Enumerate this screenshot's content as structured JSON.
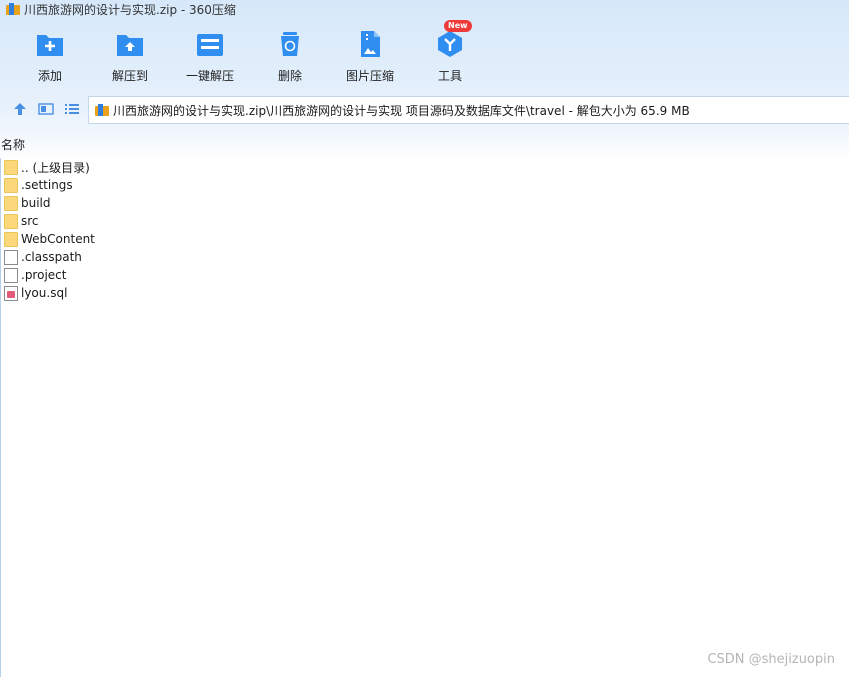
{
  "window": {
    "title": "川西旅游网的设计与实现.zip - 360压缩"
  },
  "toolbar": {
    "buttons": [
      {
        "label": "添加",
        "icon": "add-folder-icon"
      },
      {
        "label": "解压到",
        "icon": "extract-to-icon"
      },
      {
        "label": "一键解压",
        "icon": "one-click-extract-icon"
      },
      {
        "label": "删除",
        "icon": "delete-icon"
      },
      {
        "label": "图片压缩",
        "icon": "image-compress-icon"
      },
      {
        "label": "工具",
        "icon": "tools-icon"
      }
    ],
    "badge": "New"
  },
  "colors": {
    "accent": "#2f8ef0",
    "folder": "#fbd97a",
    "badge": "#f03a3a"
  },
  "address": {
    "path": "川西旅游网的设计与实现.zip\\川西旅游网的设计与实现 项目源码及数据库文件\\travel - 解包大小为 65.9 MB"
  },
  "columns": {
    "name": "名称"
  },
  "files": [
    {
      "name": ".. (上级目录)",
      "type": "folder"
    },
    {
      "name": ".settings",
      "type": "folder"
    },
    {
      "name": "build",
      "type": "folder"
    },
    {
      "name": "src",
      "type": "folder"
    },
    {
      "name": "WebContent",
      "type": "folder"
    },
    {
      "name": ".classpath",
      "type": "file"
    },
    {
      "name": ".project",
      "type": "file"
    },
    {
      "name": "lyou.sql",
      "type": "sql"
    }
  ],
  "watermark": "CSDN @shejizuopin"
}
